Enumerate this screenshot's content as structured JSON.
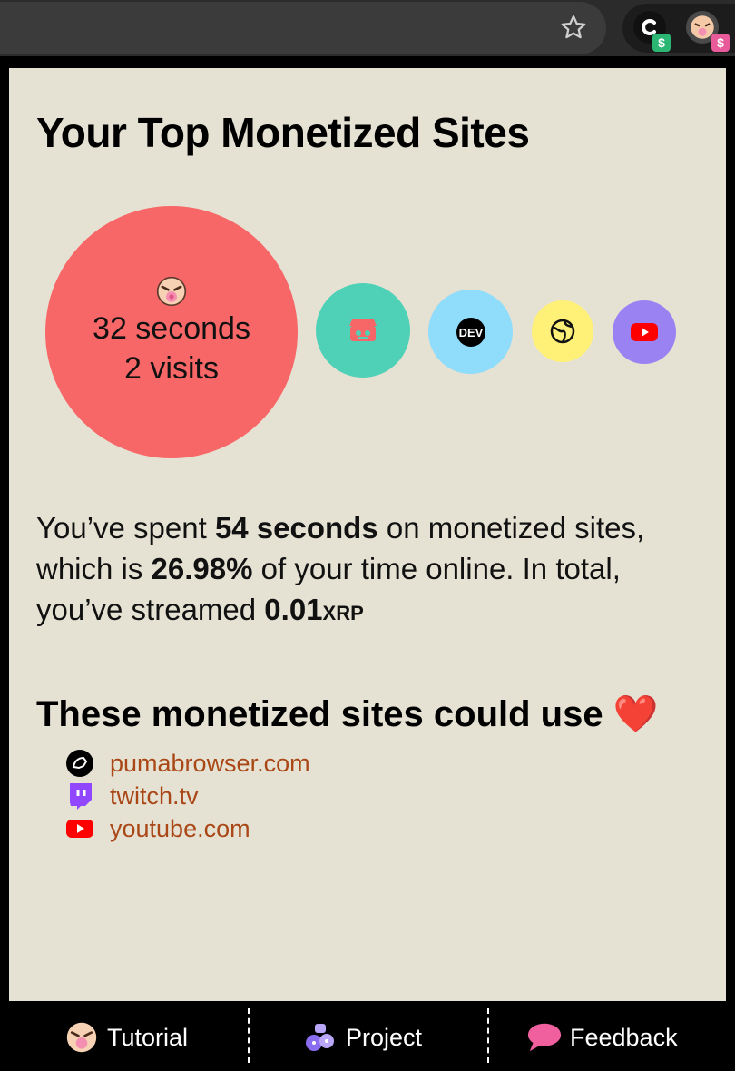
{
  "browser": {
    "star_icon": "star-icon",
    "extension_1_badge": "$",
    "extension_2_badge": "$"
  },
  "popup": {
    "title": "Your Top Monetized Sites",
    "top_site": {
      "time": "32 seconds",
      "visits": "2 visits"
    },
    "other_sites": [
      "itch-icon",
      "dev-icon",
      "globe-icon",
      "youtube-icon"
    ],
    "summary": {
      "part1": "You’ve spent ",
      "time": "54 seconds",
      "part2": " on monetized sites, which is ",
      "percent": "26.98%",
      "part3": " of your time online. In total, you’ve streamed ",
      "amount": "0.01",
      "unit": "XRP"
    },
    "love_heading": "These monetized sites could use",
    "heart": "❤️",
    "love_sites": [
      "pumabrowser.com",
      "twitch.tv",
      "youtube.com"
    ]
  },
  "footer": {
    "tutorial": "Tutorial",
    "project": "Project",
    "feedback": "Feedback"
  },
  "colors": {
    "popup_bg": "#e6e2d3",
    "bubble_main": "#f76767",
    "bubble_itch": "#4fd1b8",
    "bubble_dev": "#8fdcfb",
    "bubble_globe": "#fff077",
    "bubble_youtube": "#9a82f2",
    "link": "#a94716"
  }
}
